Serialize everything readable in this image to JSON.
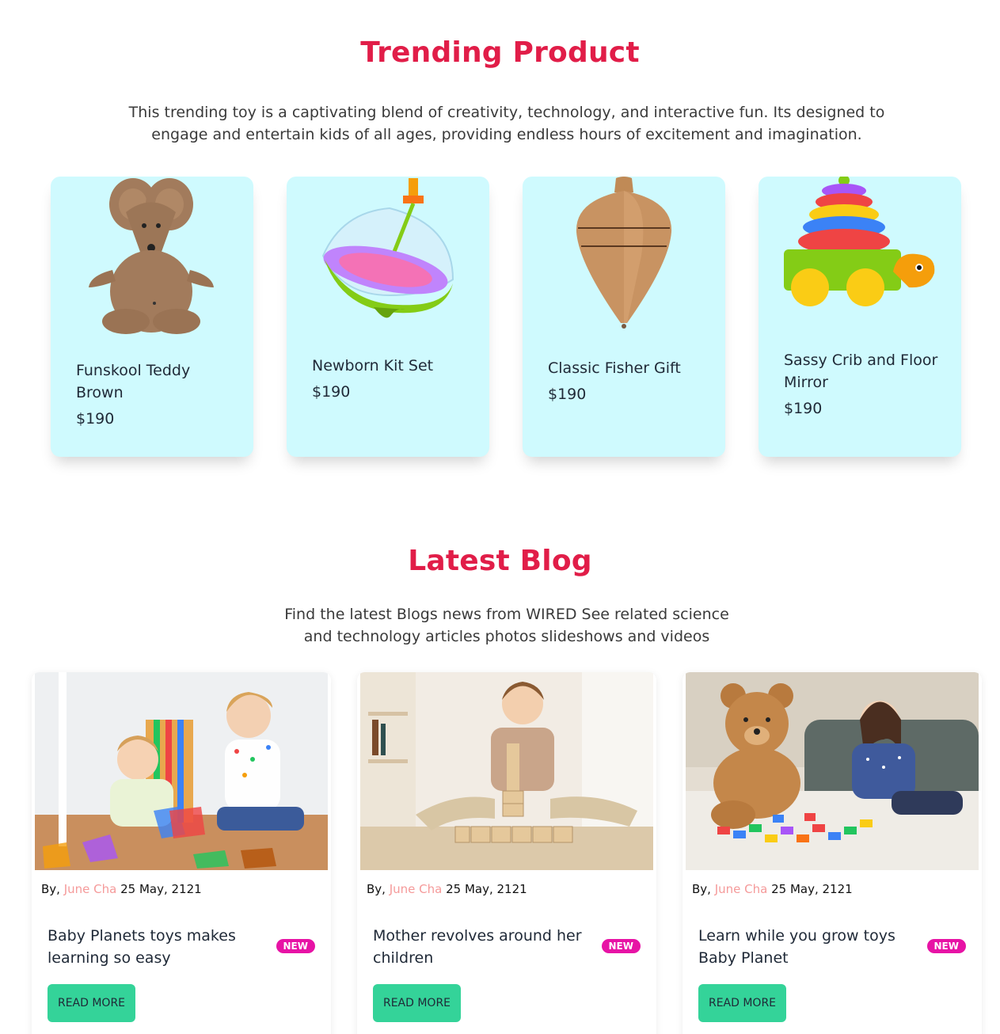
{
  "trending": {
    "title": "Trending Product",
    "description": "This trending toy is a captivating blend of creativity, technology, and interactive fun. Its designed to engage and entertain kids of all ages, providing endless hours of excitement and imagination.",
    "products": [
      {
        "name": "Funskool Teddy Brown",
        "price": "$190",
        "icon": "mouse-plush-image"
      },
      {
        "name": "Newborn Kit Set",
        "price": "$190",
        "icon": "spinning-top-image"
      },
      {
        "name": "Classic Fisher Gift",
        "price": "$190",
        "icon": "wooden-top-image"
      },
      {
        "name": "Sassy Crib and Floor Mirror",
        "price": "$190",
        "icon": "stacking-ring-turtle-image"
      }
    ]
  },
  "blog": {
    "title": "Latest Blog",
    "description": "Find the latest Blogs news from WIRED See related science and technology articles photos slideshows and videos",
    "posts": [
      {
        "by": "By,",
        "author": "June Cha",
        "date": "25 May, 2121",
        "title": "Baby Planets toys makes learning so easy",
        "badge": "NEW",
        "button": "READ MORE",
        "icon": "kids-magnetic-tiles-photo"
      },
      {
        "by": "By,",
        "author": "June Cha",
        "date": "25 May, 2121",
        "title": "Mother revolves around her children",
        "badge": "NEW",
        "button": "READ MORE",
        "icon": "boy-wooden-blocks-photo"
      },
      {
        "by": "By,",
        "author": "June Cha",
        "date": "25 May, 2121",
        "title": "Learn while you grow toys Baby Planet",
        "badge": "NEW",
        "button": "READ MORE",
        "icon": "girl-teddy-bear-photo"
      }
    ]
  },
  "colors": {
    "accent": "#e11d48",
    "card_bg": "#cffafe",
    "button": "#34d399",
    "badge": "#e713a5",
    "author": "#f59a9a"
  }
}
